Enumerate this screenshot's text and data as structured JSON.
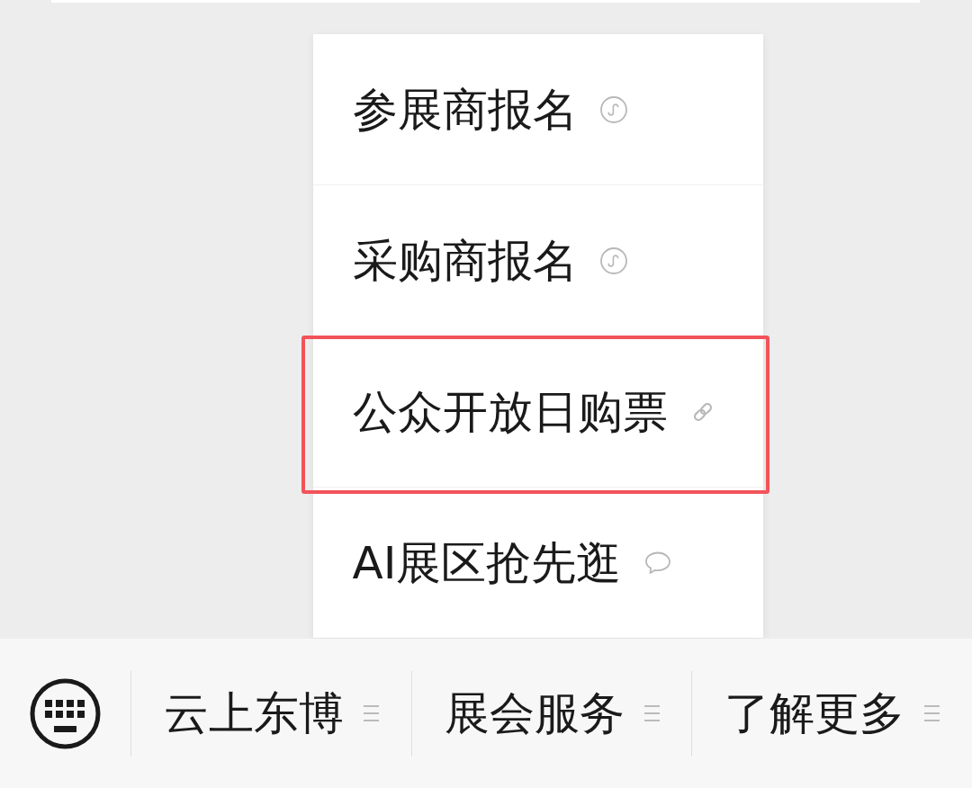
{
  "bottom_bar": {
    "menus": [
      {
        "label": "云上东博"
      },
      {
        "label": "展会服务",
        "items": [
          {
            "label": "参展商报名",
            "kind": "mini_program",
            "highlighted": false
          },
          {
            "label": "采购商报名",
            "kind": "mini_program",
            "highlighted": false
          },
          {
            "label": "公众开放日购票",
            "kind": "link",
            "highlighted": true
          },
          {
            "label": "AI展区抢先逛",
            "kind": "message",
            "highlighted": false
          }
        ]
      },
      {
        "label": "了解更多"
      }
    ]
  }
}
